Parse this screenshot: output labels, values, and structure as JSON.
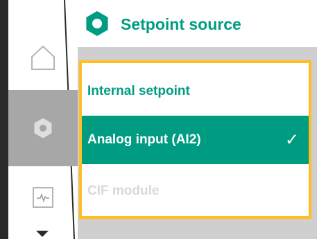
{
  "header": {
    "title": "Setpoint source",
    "icon": "gear-icon",
    "accent_color": "#009c82"
  },
  "sidebar": {
    "items": [
      {
        "icon": "home-icon",
        "active": false
      },
      {
        "icon": "gear-icon",
        "active": true
      },
      {
        "icon": "monitor-icon",
        "active": false
      }
    ],
    "scroll_indicator": "chevron-down-icon"
  },
  "options": [
    {
      "label": "Internal setpoint",
      "selected": false,
      "enabled": true
    },
    {
      "label": "Analog input (AI2)",
      "selected": true,
      "enabled": true,
      "check": "✓"
    },
    {
      "label": "CIF module",
      "selected": false,
      "enabled": false
    }
  ],
  "colors": {
    "focus_border": "#ffbf22",
    "selected_bg": "#009c82",
    "disabled_text": "#d8d8d8",
    "sidebar_active_bg": "#a7a7a7"
  }
}
